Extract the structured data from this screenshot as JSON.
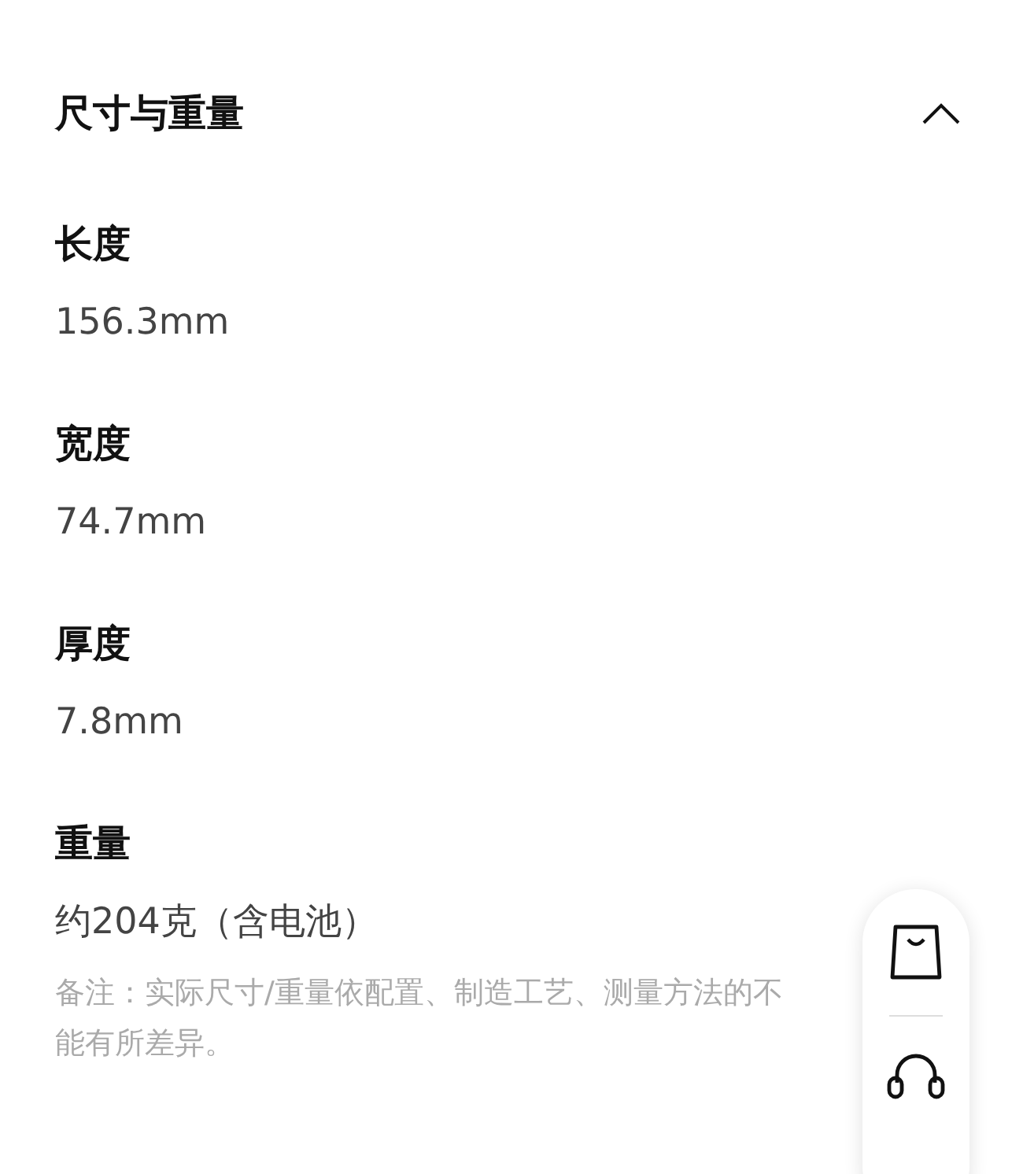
{
  "section": {
    "title": "尺寸与重量",
    "expanded": true
  },
  "specs": [
    {
      "label": "长度",
      "value": "156.3mm"
    },
    {
      "label": "宽度",
      "value": "74.7mm"
    },
    {
      "label": "厚度",
      "value": "7.8mm"
    },
    {
      "label": "重量",
      "value": "约204克（含电池）"
    }
  ],
  "note_lines": [
    "备注：实际尺寸/重量依配置、制造工艺、测量方法的不",
    "能有所差异。"
  ]
}
